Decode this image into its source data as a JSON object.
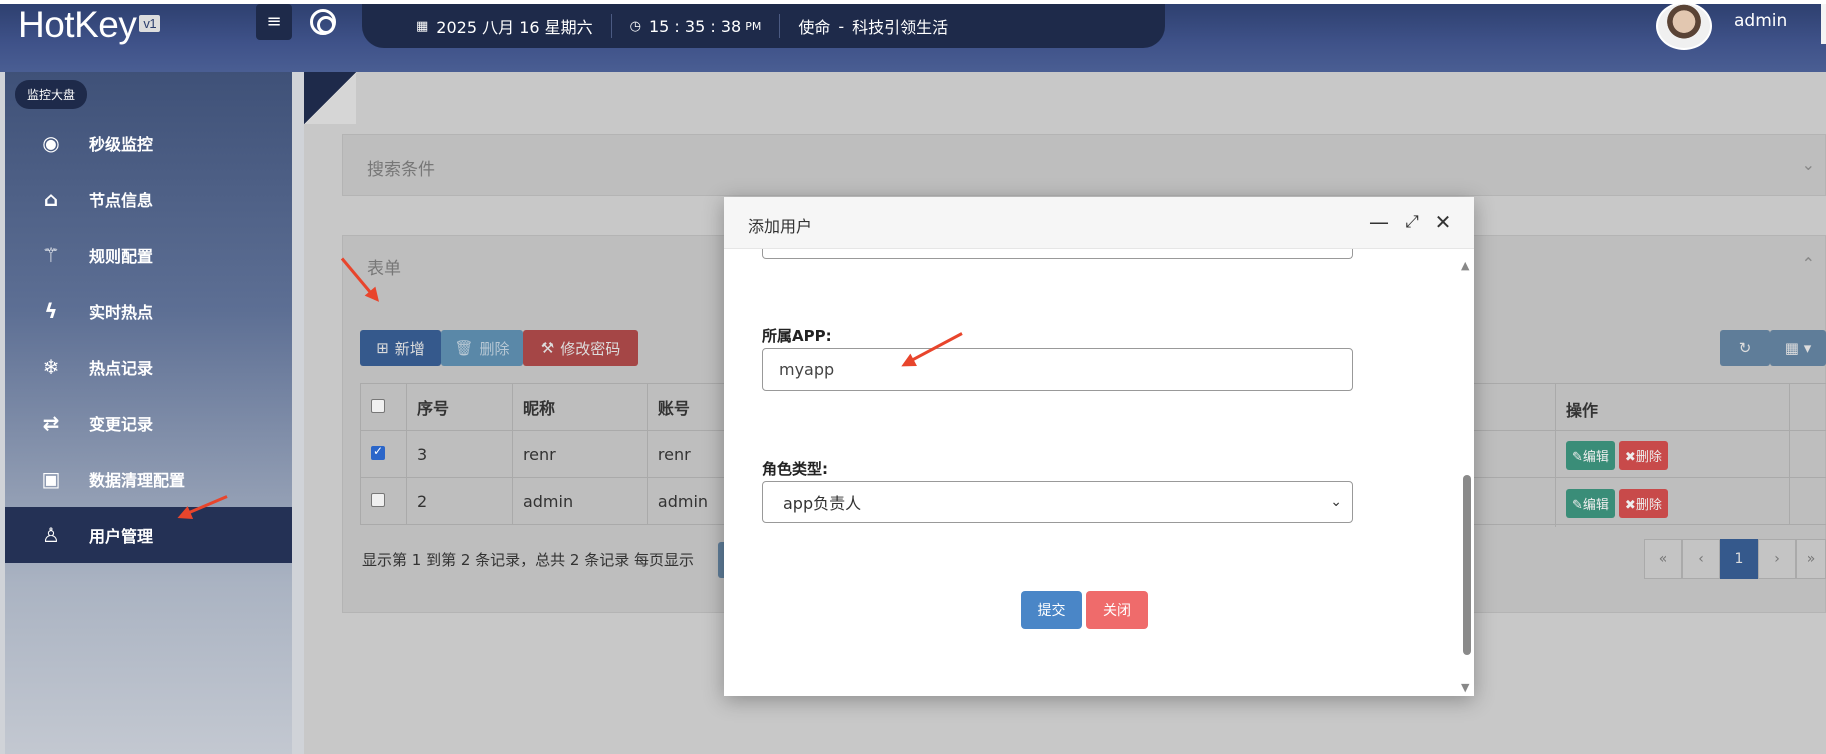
{
  "header": {
    "logo": "HotKey",
    "version": "v1",
    "date": "2025 八月 16 星期六",
    "time": "15 : 35 : 38",
    "ampm": "PM",
    "mission_label": "使命",
    "mission_sep": "-",
    "mission_text": "科技引领生活",
    "username": "admin"
  },
  "sidebar": {
    "badge": "监控大盘",
    "items": [
      {
        "label": "秒级监控",
        "icon": "eye-icon"
      },
      {
        "label": "节点信息",
        "icon": "home-icon"
      },
      {
        "label": "规则配置",
        "icon": "magic-icon"
      },
      {
        "label": "实时热点",
        "icon": "bolt-icon"
      },
      {
        "label": "热点记录",
        "icon": "snowflake-icon"
      },
      {
        "label": "变更记录",
        "icon": "retweet-icon"
      },
      {
        "label": "数据清理配置",
        "icon": "cubes-icon"
      },
      {
        "label": "用户管理",
        "icon": "user-icon"
      }
    ],
    "active_index": 7
  },
  "search_panel": {
    "title": "搜索条件"
  },
  "form_panel": {
    "title": "表单"
  },
  "toolbar": {
    "add": "新增",
    "delete": "删除",
    "change_password": "修改密码"
  },
  "table": {
    "columns": [
      "序号",
      "昵称",
      "账号",
      "操作"
    ],
    "rows": [
      {
        "checked": true,
        "index": "3",
        "nickname": "renr",
        "account": "renr"
      },
      {
        "checked": false,
        "index": "2",
        "nickname": "admin",
        "account": "admin"
      }
    ],
    "edit_label": "编辑",
    "delete_label": "删除"
  },
  "pagination": {
    "summary": "显示第 1 到第 2 条记录，总共 2 条记录 每页显示",
    "first": "«",
    "prev": "‹",
    "current": "1",
    "next": "›",
    "last": "»"
  },
  "modal": {
    "title": "添加用户",
    "app_label": "所属APP:",
    "app_value": "myapp",
    "role_label": "角色类型:",
    "role_selected": "app负责人",
    "submit": "提交",
    "close": "关闭"
  },
  "colors": {
    "primary": "#4a86c7",
    "danger": "#ef6b6b",
    "edit_green": "#3a8d78",
    "delete_red": "#c84a4a",
    "sidebar_dark": "#243155",
    "arrow_red": "#e8452c"
  }
}
